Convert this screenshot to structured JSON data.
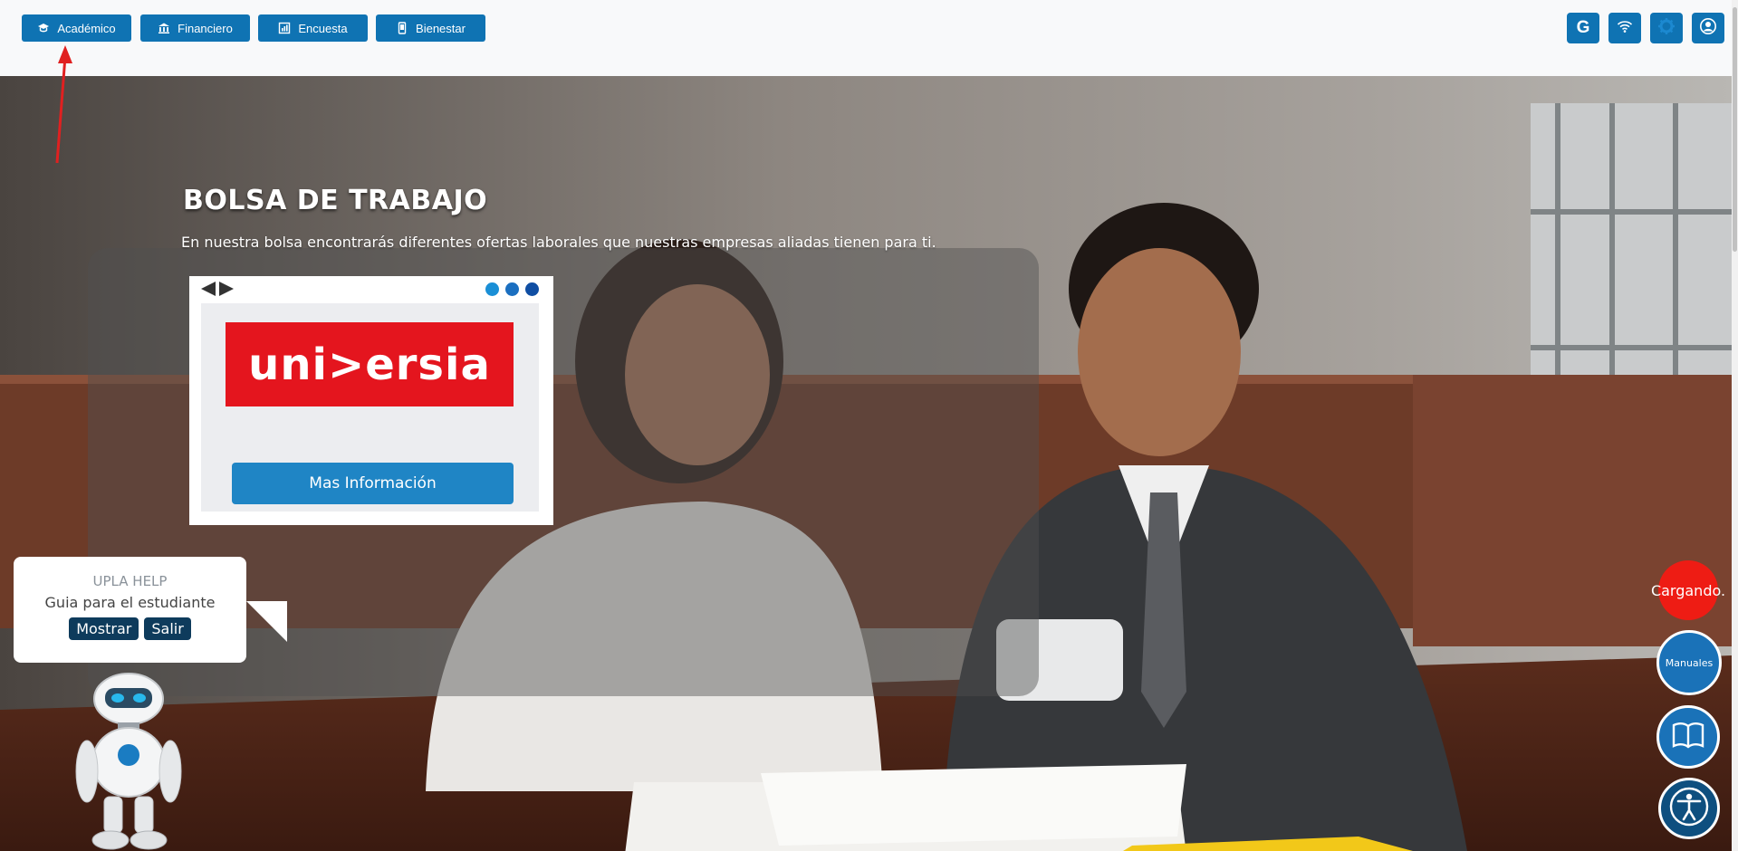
{
  "nav": {
    "items": [
      {
        "label": "Académico",
        "icon": "graduation-cap-icon"
      },
      {
        "label": "Financiero",
        "icon": "bank-icon"
      },
      {
        "label": "Encuesta",
        "icon": "survey-icon"
      },
      {
        "label": "Bienestar",
        "icon": "phone-icon"
      }
    ],
    "right_buttons": [
      {
        "label": "G",
        "icon": "google-icon"
      },
      {
        "icon": "wifi-icon"
      },
      {
        "icon": "gear-icon"
      },
      {
        "icon": "user-icon"
      }
    ]
  },
  "hero": {
    "title": "BOLSA DE TRABAJO",
    "subtitle": "En nuestra bolsa encontrarás diferentes ofertas laborales que nuestras empresas aliadas tienen para ti."
  },
  "card": {
    "brand": "uni>ersia",
    "button_label": "Mas Información",
    "dot_colors": [
      "#1a8fd6",
      "#1b6fc0",
      "#0f4ea3"
    ]
  },
  "help": {
    "title": "UPLA HELP",
    "subtitle": "Guia para el estudiante",
    "show_label": "Mostrar",
    "exit_label": "Salir"
  },
  "floating": {
    "loading_label": "Cargando.",
    "manuals_label": "Manuales"
  },
  "colors": {
    "primary": "#0f73b3",
    "loading_red": "#ee1c14",
    "dark_navy": "#0e3b5c",
    "annotation_red": "#e02020"
  }
}
